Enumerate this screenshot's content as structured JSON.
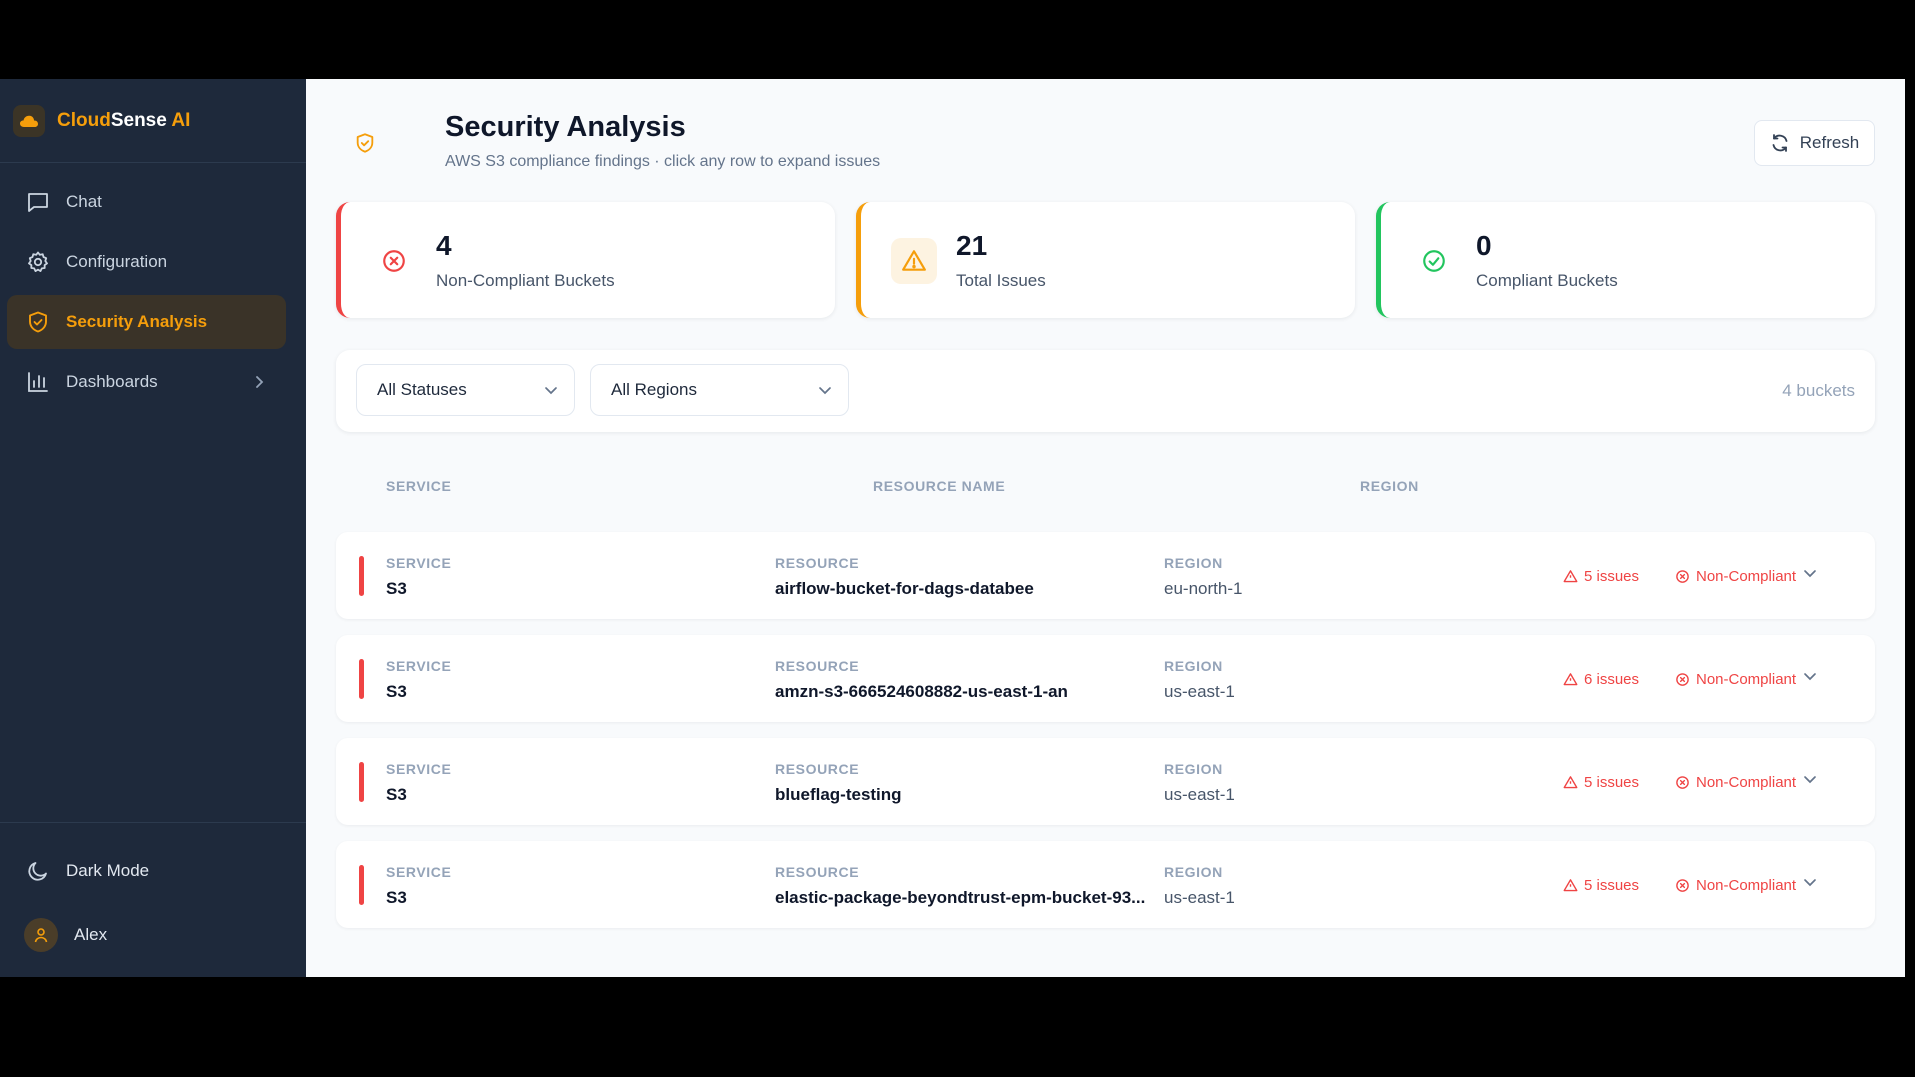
{
  "brand": {
    "part1": "Cloud",
    "part2": "Sense",
    "part3": " AI",
    "logo_icon": "cloud-icon"
  },
  "nav": {
    "items": [
      {
        "label": "Chat",
        "icon": "chat-icon"
      },
      {
        "label": "Configuration",
        "icon": "gear-icon"
      },
      {
        "label": "Security Analysis",
        "icon": "shield-icon",
        "active": true
      },
      {
        "label": "Dashboards",
        "icon": "bar-chart-icon"
      }
    ]
  },
  "sidebar_bottom": {
    "dark_mode_label": "Dark Mode",
    "user_name": "Alex"
  },
  "header": {
    "title": "Security Analysis",
    "subtitle": "AWS S3 compliance findings · click any row to expand issues",
    "refresh_label": "Refresh"
  },
  "stats": [
    {
      "value": "4",
      "label": "Non-Compliant Buckets",
      "color": "#ef4444",
      "icon": "x-circle-icon"
    },
    {
      "value": "21",
      "label": "Total Issues",
      "color": "#f59e0b",
      "icon": "warning-icon"
    },
    {
      "value": "0",
      "label": "Compliant Buckets",
      "color": "#22c55e",
      "icon": "check-circle-icon"
    }
  ],
  "filters": {
    "status_selected": "All Statuses",
    "region_selected": "All Regions",
    "bucket_count": "4 buckets"
  },
  "table": {
    "columns": [
      "SERVICE",
      "RESOURCE NAME",
      "REGION"
    ],
    "row_labels": {
      "service": "SERVICE",
      "resource": "RESOURCE",
      "region": "REGION"
    },
    "rows": [
      {
        "service": "S3",
        "resource": "airflow-bucket-for-dags-databee",
        "region": "eu-north-1",
        "issues": "5 issues",
        "status": "Non-Compliant"
      },
      {
        "service": "S3",
        "resource": "amzn-s3-666524608882-us-east-1-an",
        "region": "us-east-1",
        "issues": "6 issues",
        "status": "Non-Compliant"
      },
      {
        "service": "S3",
        "resource": "blueflag-testing",
        "region": "us-east-1",
        "issues": "5 issues",
        "status": "Non-Compliant"
      },
      {
        "service": "S3",
        "resource": "elastic-package-beyondtrust-epm-bucket-93...",
        "region": "us-east-1",
        "issues": "5 issues",
        "status": "Non-Compliant"
      }
    ]
  },
  "colors": {
    "accent": "#f59e0b",
    "sidebar_bg": "#1e293b",
    "danger": "#ef4444",
    "success": "#22c55e"
  }
}
